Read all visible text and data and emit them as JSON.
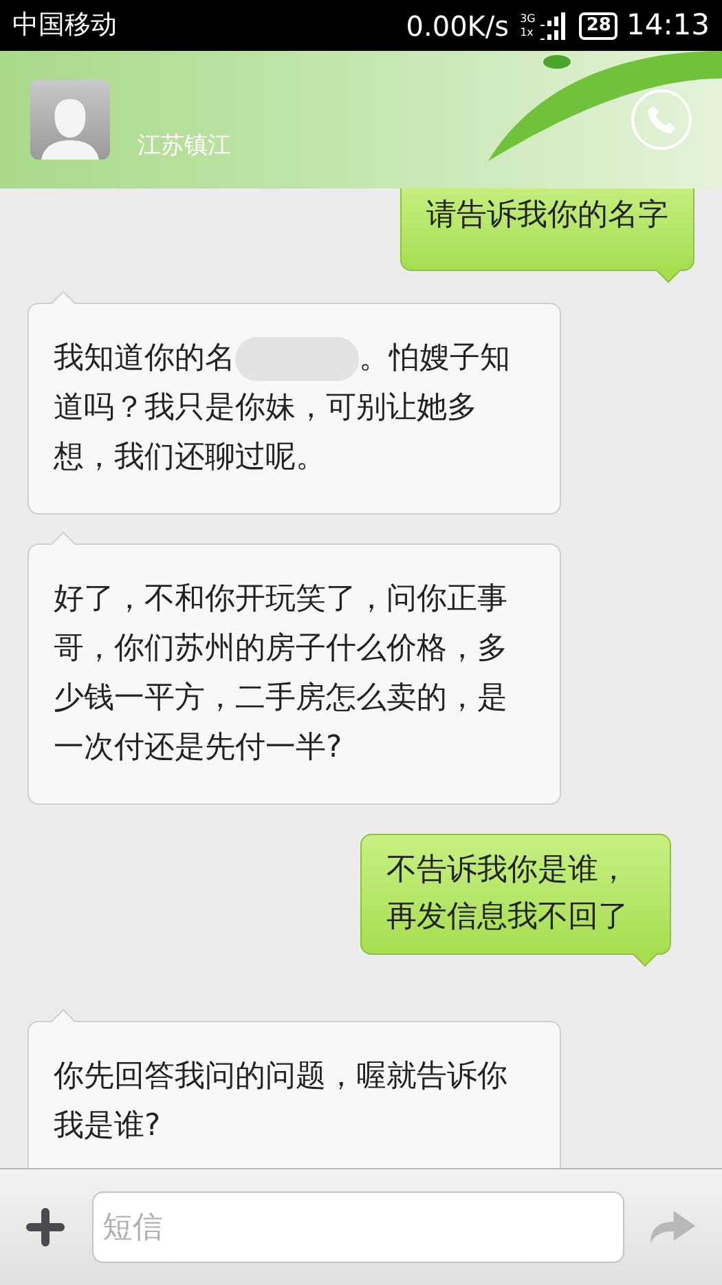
{
  "status_bar": {
    "carrier": "中国移动",
    "speed": "0.00K/s",
    "network_top": "3G",
    "network_bottom": "1x",
    "battery": "28",
    "time": "14:13"
  },
  "contact": {
    "location": "江苏镇江"
  },
  "messages": [
    {
      "kind": "outgoing",
      "parts": [
        "请告诉我你的名字"
      ]
    },
    {
      "kind": "incoming",
      "parts": [
        "我知道你的名",
        "。怕嫂子知道吗？我只是你妹，可别让她多想，我们还聊过呢。"
      ]
    },
    {
      "kind": "incoming",
      "parts": [
        "好了，不和你开玩笑了，问你正事哥，你们苏州的房子什么价格，多少钱一平方，二手房怎么卖的，是一次付还是先付一半?"
      ]
    },
    {
      "kind": "outgoing",
      "parts": [
        "不告诉我你是谁，再发信息我不回了"
      ]
    },
    {
      "kind": "incoming",
      "parts": [
        "你先回答我问的问题，喔就告诉你我是谁?"
      ]
    }
  ],
  "composer": {
    "placeholder": "短信"
  }
}
